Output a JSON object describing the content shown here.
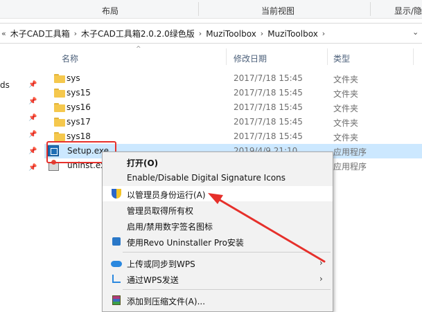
{
  "ribbon": {
    "layout_label": "布局",
    "current_view_label": "当前视图",
    "show_hide_label": "显示/隐藏"
  },
  "address": {
    "crumbs": [
      "木子CAD工具箱",
      "木子CAD工具箱2.0.2.0绿色版",
      "MuziToolbox",
      "MuziToolbox"
    ]
  },
  "nav_pane": {
    "partial_text": "ds"
  },
  "columns": {
    "name": "名称",
    "date": "修改日期",
    "type": "类型"
  },
  "files": [
    {
      "name": "sys",
      "date": "2017/7/18 15:45",
      "type": "文件夹"
    },
    {
      "name": "sys15",
      "date": "2017/7/18 15:45",
      "type": "文件夹"
    },
    {
      "name": "sys16",
      "date": "2017/7/18 15:45",
      "type": "文件夹"
    },
    {
      "name": "sys17",
      "date": "2017/7/18 15:45",
      "type": "文件夹"
    },
    {
      "name": "sys18",
      "date": "2017/7/18 15:45",
      "type": "文件夹"
    },
    {
      "name": "Setup.exe",
      "date": "2019/4/9 21:10",
      "type": "应用程序"
    },
    {
      "name": "uninst.exe",
      "date": "",
      "type": "应用程序"
    }
  ],
  "context_menu": {
    "open": "打开(O)",
    "enable_disable_sig": "Enable/Disable Digital Signature Icons",
    "run_as_admin": "以管理员身份运行(A)",
    "take_ownership": "管理员取得所有权",
    "toggle_sig_icons": "启用/禁用数字签名图标",
    "revo_uninstall": "使用Revo Uninstaller Pro安装",
    "upload_wps": "上传或同步到WPS",
    "send_wps": "通过WPS发送",
    "add_archive": "添加到压缩文件(A)...",
    "submenu_glyph": "›"
  },
  "colors": {
    "selection": "#cce8ff",
    "annotation_red": "#e6302b",
    "menu_bg": "#f2f2f2"
  }
}
